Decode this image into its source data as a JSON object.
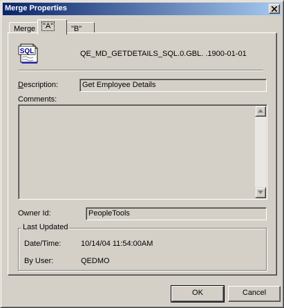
{
  "window": {
    "title": "Merge Properties"
  },
  "tabs": [
    {
      "label": "Merge",
      "active": false
    },
    {
      "label": "\"A\"",
      "active": true
    },
    {
      "label": "\"B\"",
      "active": false
    }
  ],
  "object": {
    "icon": "sql-document-icon",
    "icon_text": "SQL",
    "name": "QE_MD_GETDETAILS_SQL.0.GBL. .1900-01-01"
  },
  "fields": {
    "description_label": "Description:",
    "description_value": "Get Employee Details",
    "comments_label": "Comments:",
    "comments_value": "",
    "owner_label": "Owner Id:",
    "owner_value": "PeopleTools"
  },
  "last_updated": {
    "legend": "Last Updated",
    "datetime_label": "Date/Time:",
    "datetime_value": "10/14/04 11:54:00AM",
    "user_label": "By User:",
    "user_value": "QEDMO"
  },
  "buttons": {
    "ok": "OK",
    "cancel": "Cancel"
  },
  "colors": {
    "titlebar_start": "#0a246a",
    "titlebar_end": "#a6caf0",
    "face": "#d4d0c8"
  }
}
